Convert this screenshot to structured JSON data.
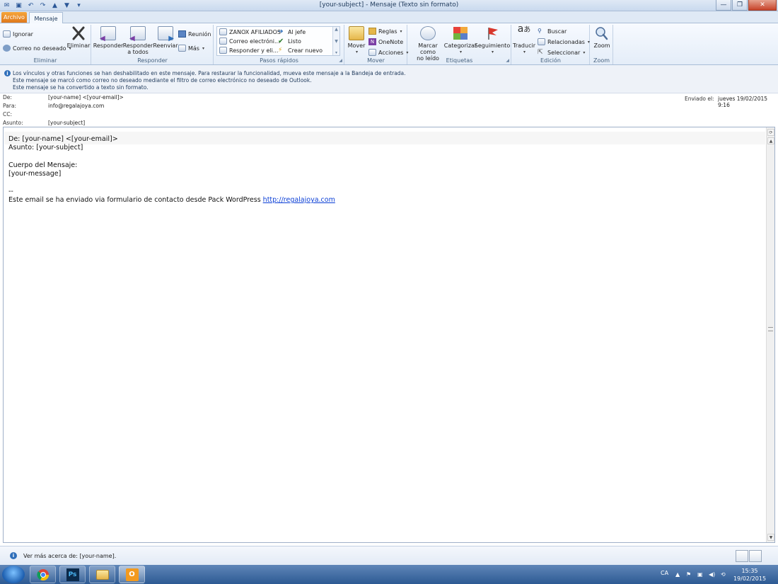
{
  "window": {
    "title": "[your-subject]  -  Mensaje (Texto sin formato)",
    "minimize": "—",
    "maximize": "❐",
    "close": "✕"
  },
  "tabs": {
    "file": "Archivo",
    "message": "Mensaje"
  },
  "ribbon": {
    "delete_group": {
      "label": "Eliminar",
      "ignore": "Ignorar",
      "junk": "Correo no deseado",
      "delete": "Eliminar"
    },
    "respond_group": {
      "label": "Responder",
      "reply": "Responder",
      "reply_all_1": "Responder",
      "reply_all_2": "a todos",
      "forward": "Reenviar",
      "meeting": "Reunión",
      "more": "Más"
    },
    "quick_steps": {
      "label": "Pasos rápidos",
      "items": [
        "ZANOX AFILIADOS",
        "Correo electróni...",
        "Responder y eli...",
        "Al jefe",
        "Listo",
        "Crear nuevo"
      ]
    },
    "move_group": {
      "label": "Mover",
      "move": "Mover",
      "rules": "Reglas",
      "onenote": "OneNote",
      "actions": "Acciones"
    },
    "tags_group": {
      "label": "Etiquetas",
      "mark_unread_1": "Marcar como",
      "mark_unread_2": "no leído",
      "categorize": "Categorizar",
      "followup": "Seguimiento"
    },
    "edit_group": {
      "label": "Edición",
      "translate": "Traducir",
      "find": "Buscar",
      "related": "Relacionadas",
      "select": "Seleccionar"
    },
    "zoom_group": {
      "label": "Zoom",
      "zoom": "Zoom"
    }
  },
  "infobar": {
    "line1": "Los vínculos y otras funciones se han deshabilitado en este mensaje. Para restaurar la funcionalidad, mueva este mensaje a la Bandeja de entrada.",
    "line2": "Este mensaje se marcó como correo no deseado mediante el filtro de correo electrónico no deseado de Outlook.",
    "line3": "Este mensaje se ha convertido a texto sin formato."
  },
  "headers": {
    "from_label": "De:",
    "from_value": "[your-name] <[your-email]>",
    "to_label": "Para:",
    "to_value": "info@regalajoya.com",
    "cc_label": "CC:",
    "cc_value": "",
    "subject_label": "Asunto:",
    "subject_value": "[your-subject]",
    "sent_label": "Enviado el:",
    "sent_value": "jueves 19/02/2015 9:16"
  },
  "body": {
    "lines": [
      "De: [your-name] <[your-email]>",
      "Asunto: [your-subject]",
      "",
      "Cuerpo del Mensaje:",
      "[your-message]",
      "",
      "--"
    ],
    "footer_text": "Este email se ha enviado via formulario de contacto desde Pack WordPress ",
    "footer_link": "http://regalajoya.com"
  },
  "people_pane": {
    "text": "Ver más acerca de: [your-name]."
  },
  "taskbar": {
    "lang": "CA",
    "time": "15:35",
    "date": "19/02/2015"
  },
  "colors": {
    "accent": "#2b5797",
    "file_tab": "#e0791c",
    "link": "#0b3fd6",
    "taskbar": "#2d5a93"
  }
}
